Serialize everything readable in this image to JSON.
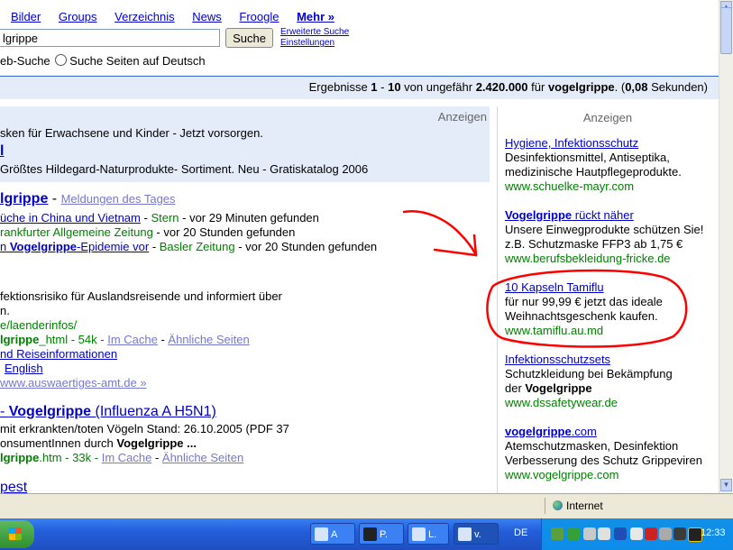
{
  "nav": {
    "items": [
      "Bilder",
      "Groups",
      "Verzeichnis",
      "News",
      "Froogle"
    ],
    "more": "Mehr »"
  },
  "search": {
    "query": "lgrippe",
    "button": "Suche",
    "advanced": "Erweiterte Suche",
    "settings": "Einstellungen",
    "option_web": "eb-Suche",
    "option_de": "Suche Seiten auf Deutsch"
  },
  "results_bar": {
    "prefix": "Ergebnisse ",
    "from": "1",
    "dash": " - ",
    "to": "10",
    "mid": " von ungefähr ",
    "total": "2.420.000",
    "for": " für ",
    "term": "vogelgrippe",
    "dot": ". (",
    "time": "0,08",
    "suffix": " Sekunden)"
  },
  "top_ads": {
    "label": "Anzeigen",
    "line1": "sken für Erwachsene und Kinder - Jetzt vorsorgen.",
    "line2_link": "l",
    "line3": "Größtes Hildegard-Naturprodukte- Sortiment. Neu - Gratiskatalog 2006"
  },
  "news": {
    "title": "lgrippe",
    "title_sep": " - ",
    "news_link": "Meldungen des Tages",
    "items": [
      {
        "link": "üche in China und Vietnam",
        "sep": " - ",
        "source": "Stern",
        "time": " - vor 29 Minuten gefunden"
      },
      {
        "link": "rankfurter Allgemeine Zeitung",
        "sep": "",
        "source": "",
        "time": " - vor 20 Stunden gefunden"
      },
      {
        "link_pre": "n ",
        "link_bold": "Vogelgrippe",
        "link_post": "-Epidemie vor",
        "sep": " - ",
        "source": "Basler Zeitung",
        "time": " - vor 20 Stunden gefunden"
      }
    ]
  },
  "result1": {
    "snippet1": "fektionsrisiko für Auslandsreisende und informiert über",
    "snippet2": "n.",
    "url1": "e/laenderinfos/",
    "url2_bold": "lgrippe",
    "url2_rest": "_html - 54k - ",
    "cache": "Im Cache",
    "similar": "Ähnliche Seiten",
    "sub1": "nd Reiseinformationen",
    "sub2": "English",
    "more": "www.auswaertiges-amt.de »"
  },
  "result2": {
    "title_pre": "- ",
    "title_bold": "Vogelgrippe",
    "title_post": " (Influenza A H5N1)",
    "snippet1": "mit erkrankten/toten Vögeln Stand: 26.10.2005 (PDF 37",
    "snippet2_pre": "onsumentInnen durch ",
    "snippet2_bold": "Vogelgrippe ...",
    "url_bold": "lgrippe",
    "url_rest": ".htm - 33k - ",
    "cache": "Im Cache",
    "similar": "Ähnliche Seiten"
  },
  "result3": {
    "title": "pest"
  },
  "side_ads": {
    "label": "Anzeigen",
    "ads": [
      {
        "title": "Hygiene, Infektionsschutz",
        "l1": "Desinfektionsmittel, Antiseptika,",
        "l2": "medizinische Hautpflegeprodukte.",
        "url": "www.schuelke-mayr.com"
      },
      {
        "title_bold": "Vogelgrippe",
        "title_rest": " rückt näher",
        "l1": "Unsere Einwegprodukte schützen Sie!",
        "l2": "z.B. Schutzmaske FFP3 ab 1,75 €",
        "url": "www.berufsbekleidung-fricke.de"
      },
      {
        "title": "10 Kapseln Tamiflu",
        "l1": "für nur 99,99 € jetzt das ideale",
        "l2": "Weihnachtsgeschenk kaufen.",
        "url": "www.tamiflu.au.md"
      },
      {
        "title": "Infektionsschutzsets",
        "l1": "Schutzkleidung bei Bekämpfung",
        "l2_pre": "der ",
        "l2_bold": "Vogelgrippe",
        "url": "www.dssafetywear.de"
      },
      {
        "title_bold": "vogelgrippe",
        "title_rest": ".com",
        "l1": "Atemschutzmasken, Desinfektion",
        "l2": "Verbesserung des Schutz Grippeviren",
        "url": "www.vogelgrippe.com"
      }
    ]
  },
  "status": {
    "zone": "Internet"
  },
  "taskbar": {
    "tasks": [
      {
        "label": "A"
      },
      {
        "label": "P."
      },
      {
        "label": "L."
      },
      {
        "label": "v."
      }
    ],
    "lang": "DE",
    "clock": "12:33"
  },
  "colors": {
    "link": "#0000cc",
    "url_green": "#008000",
    "annotation_red": "#ff0000",
    "ad_bg": "#e5ecf9"
  }
}
